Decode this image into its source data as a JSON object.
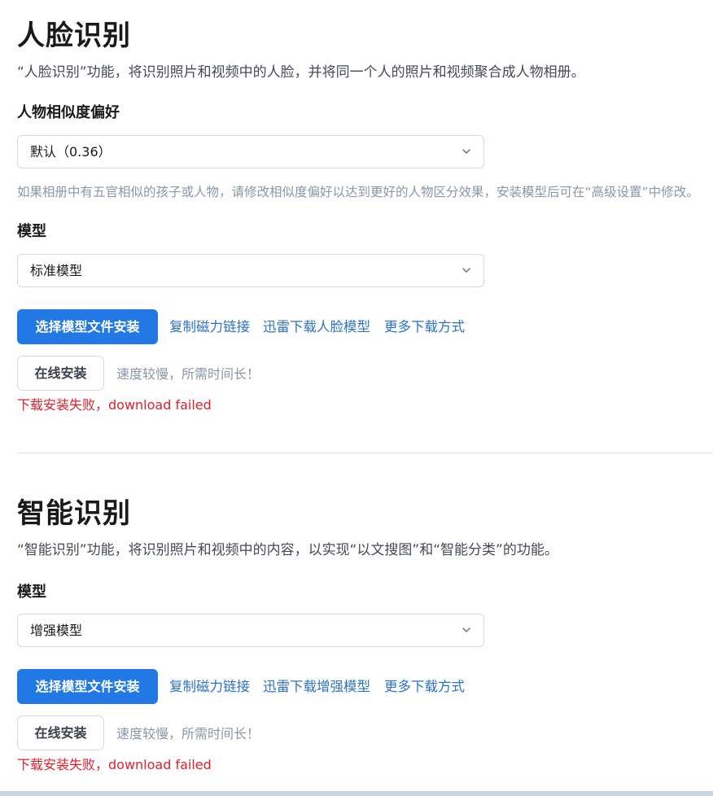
{
  "face": {
    "title": "人脸识别",
    "description": "“人脸识别”功能，将识别照片和视频中的人脸，并将同一个人的照片和视频聚合成人物相册。",
    "similarity_label": "人物相似度偏好",
    "similarity_value": "默认（0.36）",
    "similarity_hint": "如果相册中有五官相似的孩子或人物，请修改相似度偏好以达到更好的人物区分效果，安装模型后可在“高级设置”中修改。",
    "model_label": "模型",
    "model_value": "标准模型",
    "install_file_button": "选择模型文件安装",
    "copy_magnet_link": "复制磁力链接",
    "thunder_download_link": "迅雷下载人脸模型",
    "more_download_link": "更多下载方式",
    "online_install_button": "在线安装",
    "online_install_note": "速度较慢，所需时间长！",
    "error_text": "下载安装失败，download failed"
  },
  "smart": {
    "title": "智能识别",
    "description": "“智能识别”功能，将识别照片和视频中的内容，以实现“以文搜图”和“智能分类”的功能。",
    "model_label": "模型",
    "model_value": "增强模型",
    "install_file_button": "选择模型文件安装",
    "copy_magnet_link": "复制磁力链接",
    "thunder_download_link": "迅雷下载增强模型",
    "more_download_link": "更多下载方式",
    "online_install_button": "在线安装",
    "online_install_note": "速度较慢，所需时间长！",
    "error_text": "下载安装失败，download failed"
  },
  "colors": {
    "primary": "#2279e6",
    "link": "#2b72c9",
    "error": "#e0202d",
    "hint": "#8a97a8"
  },
  "icons": {
    "dropdown": "chevron-down-icon"
  }
}
